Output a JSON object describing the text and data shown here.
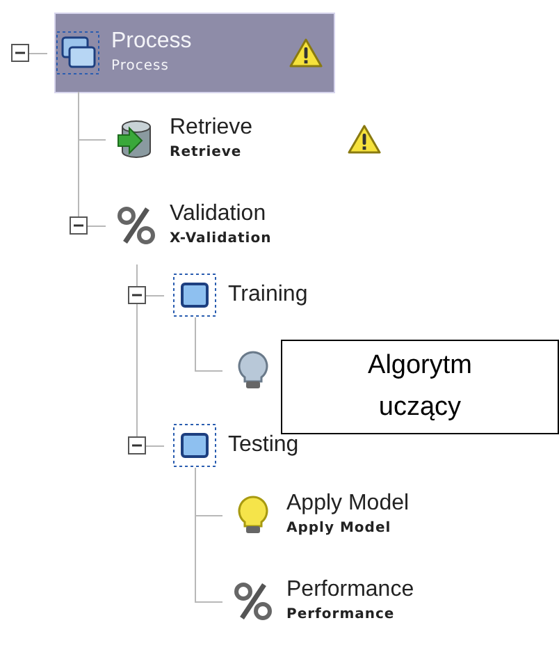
{
  "tree": [
    {
      "label": "Process",
      "sublabel": "Process",
      "kind": "process",
      "selected": true,
      "expanded": true,
      "warning": true,
      "children": [
        {
          "label": "Retrieve",
          "sublabel": "Retrieve",
          "kind": "database",
          "selected": false,
          "warning": true
        },
        {
          "label": "Validation",
          "sublabel": "X-Validation",
          "kind": "percent",
          "selected": false,
          "expanded": true,
          "warning": false,
          "children": [
            {
              "label": "Training",
              "kind": "subprocess",
              "selected": false,
              "expanded": true,
              "warning": false,
              "children": [
                {
                  "kind": "bulb",
                  "lit": false,
                  "selected": false,
                  "warning": false
                }
              ]
            },
            {
              "label": "Testing",
              "kind": "subprocess",
              "selected": false,
              "expanded": true,
              "warning": false,
              "children": [
                {
                  "label": "Apply Model",
                  "sublabel": "Apply Model",
                  "kind": "bulb",
                  "lit": true,
                  "selected": false,
                  "warning": false
                },
                {
                  "label": "Performance",
                  "sublabel": "Performance",
                  "kind": "percent",
                  "selected": false,
                  "warning": false
                }
              ]
            }
          ]
        }
      ]
    }
  ],
  "overlay_note": {
    "lines": [
      "Algorytm",
      "uczący"
    ]
  }
}
